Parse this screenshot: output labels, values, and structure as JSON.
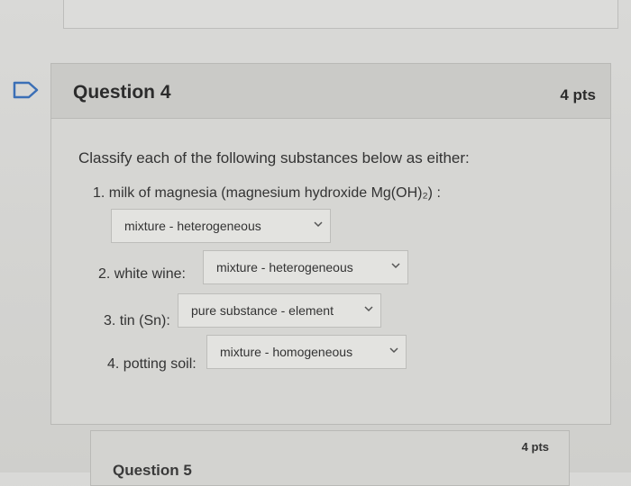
{
  "question": {
    "title": "Question 4",
    "points": "4 pts",
    "prompt": "Classify each of the following substances below as either:",
    "items": [
      {
        "label": "1. milk of magnesia (magnesium hydroxide Mg(OH)₂) :",
        "selected": "mixture - heterogeneous"
      },
      {
        "label": "2. white wine:",
        "selected": "mixture - heterogeneous"
      },
      {
        "label": "3. tin (Sn):",
        "selected": "pure substance - element"
      },
      {
        "label": "4. potting soil:",
        "selected": "mixture - homogeneous"
      }
    ]
  },
  "next_question": {
    "title": "Question 5",
    "points": "4 pts"
  },
  "icons": {
    "flag": "flag-icon",
    "dropdown": "chevron-down-icon"
  }
}
